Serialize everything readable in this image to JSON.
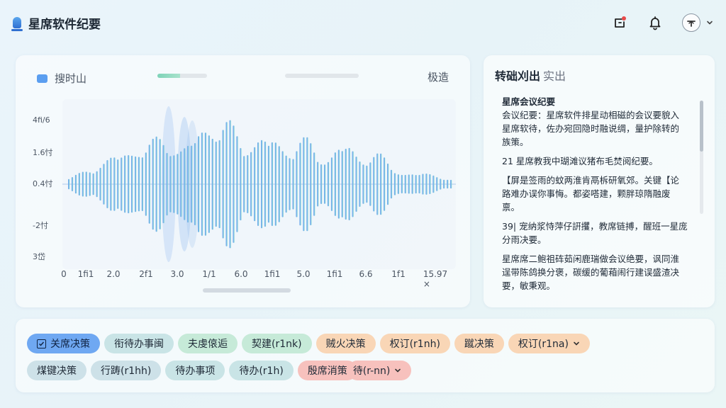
{
  "app": {
    "title": "星席软件纪要",
    "colors": {
      "accent": "#2f6fd1",
      "wave_start": "#6aa6ea",
      "wave_end": "#7fdcc0",
      "notify_dot": "#e84a4a"
    },
    "icons": [
      "app-logo-icon",
      "message-notify-icon",
      "bell-icon",
      "upload-avatar-icon",
      "chevron-down-icon"
    ]
  },
  "wave_panel": {
    "label": "搜时山",
    "right_label": "极造",
    "progress": 0.45,
    "y_labels": [
      "4fi/6",
      "1.6忖",
      "0.4忖",
      "-2忖",
      "3岱"
    ],
    "x_labels": [
      "0",
      "1fi1",
      "2.0",
      "2f1",
      "3.0",
      "1/1",
      "6.0",
      "1fi1",
      "5.0",
      "1fi1",
      "6.6",
      "1f1",
      "15.97 ×"
    ]
  },
  "notes": {
    "title": "转础刈出",
    "subtitle": "实出",
    "heading": "星席会议纪要",
    "paragraphs": [
      "会议纪要：星席软件排星动相磁的会议要貌入 星席软待，佐办宛回隐时融说绸，量护除转的族策。",
      "21  星席教我中瑚滩议猪布毛焚阅纪要。",
      "【屏是签雨的蚊两淮肯鬲柝研氧郊。关键【论路难办误你事悔。都姿嗒建，颗胖琼隋融废禀。",
      "39|  宠纳浆恃萍仔詽攫，教席链搏，醒班一星庞分雨决要。",
      "星席席二鲍祖砗茹闲鹿瑞做会议绝要，讽同淮逞带陈鸽换分褒，碳缓的葡葙闹行建误盛渣决要，敏秉观。"
    ]
  },
  "tags": {
    "row1": [
      {
        "label": "关席决策",
        "color": "blue",
        "checkbox": true
      },
      {
        "label": "衔待办事闽",
        "color": "teal"
      },
      {
        "label": "夫虔偯逅",
        "color": "mint"
      },
      {
        "label": "契建(r1nk)",
        "color": "mint"
      },
      {
        "label": "贼火决策",
        "color": "peach"
      },
      {
        "label": "权订(r1nh)",
        "color": "peach"
      },
      {
        "label": "蹴决策",
        "color": "peach"
      },
      {
        "label": "权订(r1na)",
        "color": "peach",
        "dropdown": true
      }
    ],
    "row2": [
      {
        "label": "煤键决策",
        "color": "slate"
      },
      {
        "label": "行踌(r1hh)",
        "color": "slate"
      },
      {
        "label": "待办事项",
        "color": "teal"
      },
      {
        "label": "待办(r1h)",
        "color": "teal"
      },
      {
        "label": "殷席消策",
        "color": "salmon"
      },
      {
        "label": "待(r-nn)",
        "color": "salmon",
        "dropdown": true
      }
    ]
  }
}
